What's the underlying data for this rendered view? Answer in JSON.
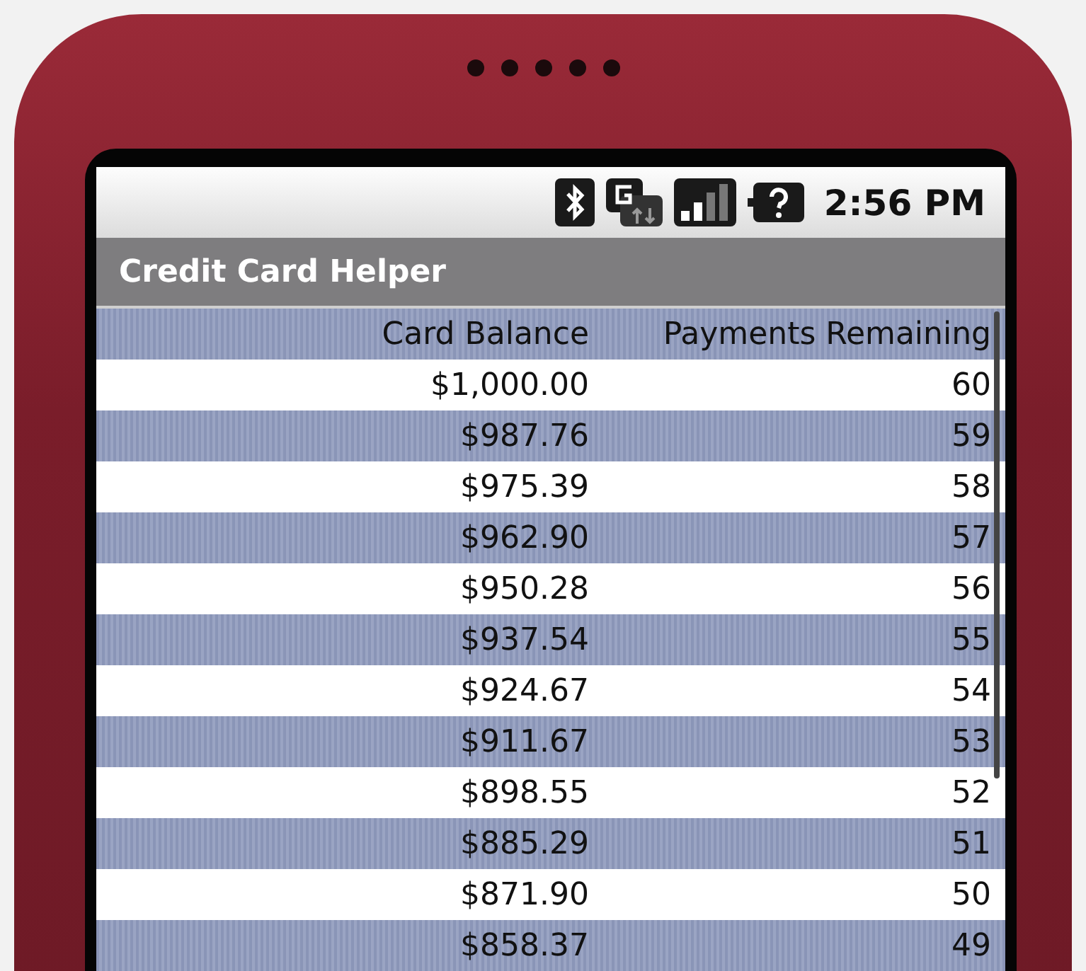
{
  "status_bar": {
    "time": "2:56 PM"
  },
  "app": {
    "title": "Credit Card Helper"
  },
  "table": {
    "columns": [
      "Card Balance",
      "Payments Remaining"
    ],
    "rows": [
      {
        "balance": "$1,000.00",
        "payments": "60"
      },
      {
        "balance": "$987.76",
        "payments": "59"
      },
      {
        "balance": "$975.39",
        "payments": "58"
      },
      {
        "balance": "$962.90",
        "payments": "57"
      },
      {
        "balance": "$950.28",
        "payments": "56"
      },
      {
        "balance": "$937.54",
        "payments": "55"
      },
      {
        "balance": "$924.67",
        "payments": "54"
      },
      {
        "balance": "$911.67",
        "payments": "53"
      },
      {
        "balance": "$898.55",
        "payments": "52"
      },
      {
        "balance": "$885.29",
        "payments": "51"
      },
      {
        "balance": "$871.90",
        "payments": "50"
      },
      {
        "balance": "$858.37",
        "payments": "49"
      }
    ]
  }
}
